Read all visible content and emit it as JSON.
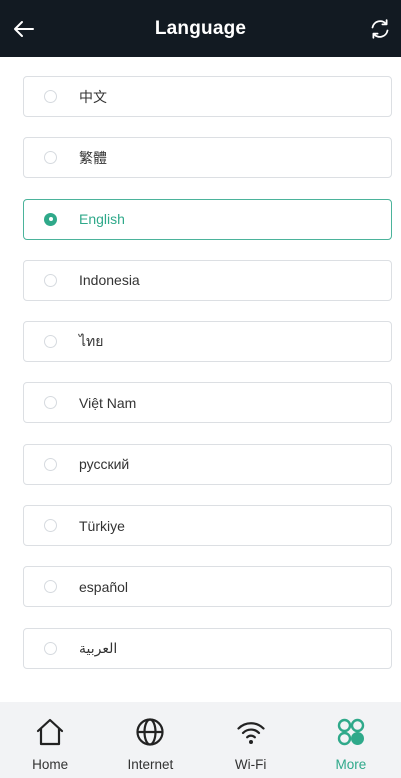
{
  "header": {
    "title": "Language",
    "back_icon": "arrow-left-icon",
    "refresh_icon": "refresh-icon"
  },
  "languages": [
    {
      "label": "中文",
      "selected": false
    },
    {
      "label": "繁體",
      "selected": false
    },
    {
      "label": "English",
      "selected": true
    },
    {
      "label": "Indonesia",
      "selected": false
    },
    {
      "label": "ไทย",
      "selected": false
    },
    {
      "label": "Việt Nam",
      "selected": false
    },
    {
      "label": "русский",
      "selected": false
    },
    {
      "label": "Türkiye",
      "selected": false
    },
    {
      "label": "español",
      "selected": false
    },
    {
      "label": "العربية",
      "selected": false
    }
  ],
  "tabbar": [
    {
      "label": "Home",
      "icon": "home-icon",
      "active": false
    },
    {
      "label": "Internet",
      "icon": "globe-icon",
      "active": false
    },
    {
      "label": "Wi-Fi",
      "icon": "wifi-icon",
      "active": false
    },
    {
      "label": "More",
      "icon": "more-icon",
      "active": true
    }
  ],
  "colors": {
    "header_bg": "#121a22",
    "accent": "#2fa98a",
    "tabbar_bg": "#f2f3f5",
    "border": "#dcdfe3"
  }
}
